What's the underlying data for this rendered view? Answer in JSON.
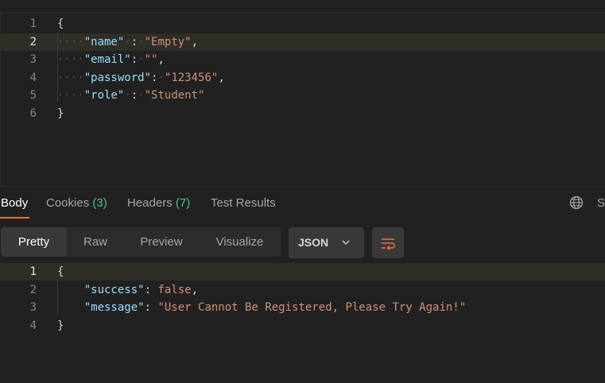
{
  "request_body": {
    "lines": [
      {
        "num": "1",
        "ws": "",
        "parts": [
          [
            "b",
            "{"
          ]
        ]
      },
      {
        "num": "2",
        "ws": "····",
        "parts": [
          [
            "k",
            "\"name\""
          ],
          [
            "ws",
            "·"
          ],
          [
            "p",
            ":"
          ],
          [
            "ws",
            "·"
          ],
          [
            "s",
            "\"Empty\""
          ],
          [
            "p",
            ","
          ]
        ]
      },
      {
        "num": "3",
        "ws": "····",
        "parts": [
          [
            "k",
            "\"email\""
          ],
          [
            "p",
            ":"
          ],
          [
            "ws",
            "·"
          ],
          [
            "s",
            "\"\""
          ],
          [
            "p",
            ","
          ]
        ]
      },
      {
        "num": "4",
        "ws": "····",
        "parts": [
          [
            "k",
            "\"password\""
          ],
          [
            "p",
            ":"
          ],
          [
            "ws",
            "·"
          ],
          [
            "s",
            "\"123456\""
          ],
          [
            "p",
            ","
          ]
        ]
      },
      {
        "num": "5",
        "ws": "····",
        "parts": [
          [
            "k",
            "\"role\""
          ],
          [
            "ws",
            "·"
          ],
          [
            "p",
            ":"
          ],
          [
            "ws",
            "·"
          ],
          [
            "s",
            "\"Student\""
          ]
        ]
      },
      {
        "num": "6",
        "ws": "",
        "parts": [
          [
            "b",
            "}"
          ]
        ]
      }
    ]
  },
  "response_tabs": {
    "body": "Body",
    "cookies": "Cookies",
    "cookies_count": "(3)",
    "headers": "Headers",
    "headers_count": "(7)",
    "test_results": "Test Results",
    "save_partial": "S"
  },
  "view_modes": [
    "Pretty",
    "Raw",
    "Preview",
    "Visualize"
  ],
  "format_select": "JSON",
  "response_body": {
    "lines": [
      {
        "num": "1",
        "parts": [
          [
            "b",
            "{"
          ]
        ]
      },
      {
        "num": "2",
        "parts": [
          [
            "ws",
            "    "
          ],
          [
            "k",
            "\"success\""
          ],
          [
            "p",
            ": "
          ],
          [
            "bool",
            "false"
          ],
          [
            "p",
            ","
          ]
        ]
      },
      {
        "num": "3",
        "parts": [
          [
            "ws",
            "    "
          ],
          [
            "k",
            "\"message\""
          ],
          [
            "p",
            ": "
          ],
          [
            "s",
            "\"User Cannot Be Registered, Please Try Again!\""
          ]
        ]
      },
      {
        "num": "4",
        "parts": [
          [
            "b",
            "}"
          ]
        ]
      }
    ]
  },
  "colors": {
    "accent": "#ff6c37",
    "count": "#4fc27d",
    "json_key": "#9cdcfe",
    "json_string": "#ce9178"
  }
}
